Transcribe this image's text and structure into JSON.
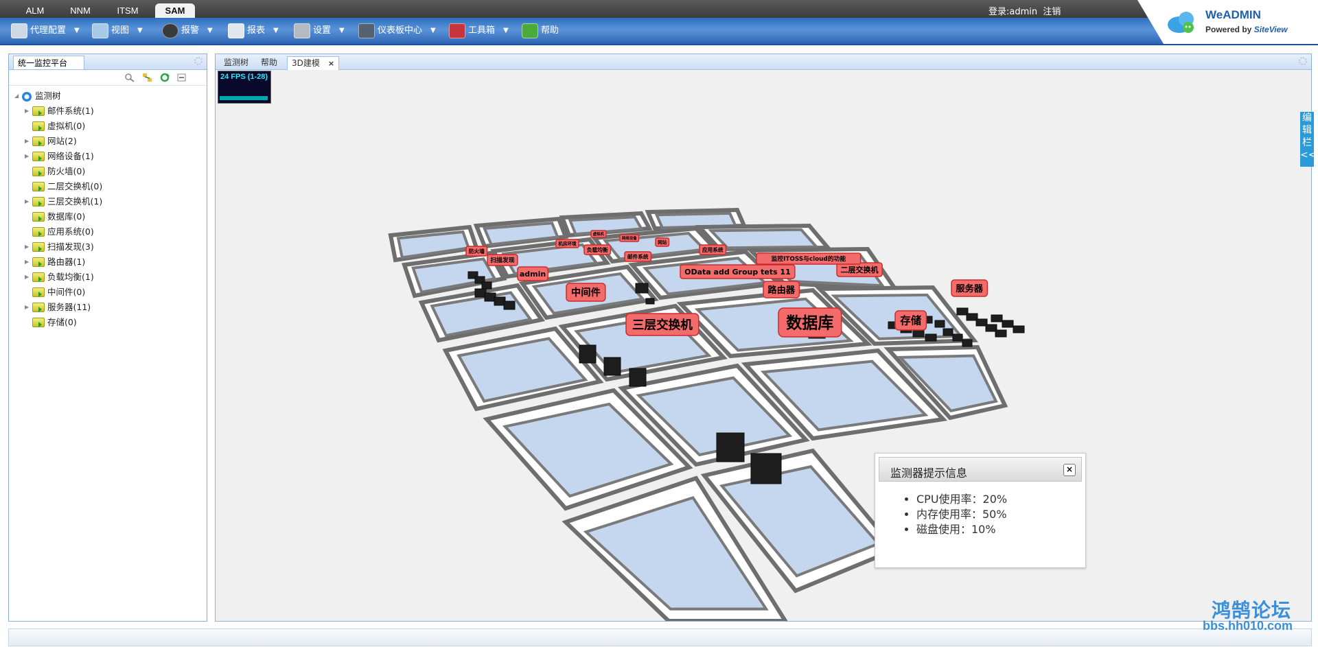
{
  "app_tabs": [
    "ALM",
    "NNM",
    "ITSM",
    "SAM"
  ],
  "login": {
    "user": "登录:admin",
    "logout": "注销"
  },
  "menu": [
    "代理配置",
    "视图",
    "报警",
    "报表",
    "设置",
    "仪表板中心",
    "工具箱",
    "帮助"
  ],
  "brand": {
    "name": "WeADMIN",
    "powered": "Powered by",
    "maker": "SiteView"
  },
  "left_panel": {
    "tab": "统一监控平台",
    "tree_root": "监测树",
    "tree_items": [
      {
        "label": "邮件系统(1)",
        "expandable": true
      },
      {
        "label": "虚拟机(0)",
        "expandable": false
      },
      {
        "label": "网站(2)",
        "expandable": true
      },
      {
        "label": "网络设备(1)",
        "expandable": true
      },
      {
        "label": "防火墙(0)",
        "expandable": false
      },
      {
        "label": "二层交换机(0)",
        "expandable": false
      },
      {
        "label": "三层交换机(1)",
        "expandable": true
      },
      {
        "label": "数据库(0)",
        "expandable": false
      },
      {
        "label": "应用系统(0)",
        "expandable": false
      },
      {
        "label": "扫描发现(3)",
        "expandable": true
      },
      {
        "label": "路由器(1)",
        "expandable": true
      },
      {
        "label": "负载均衡(1)",
        "expandable": true
      },
      {
        "label": "中间件(0)",
        "expandable": false
      },
      {
        "label": "服务器(11)",
        "expandable": true
      },
      {
        "label": "存储(0)",
        "expandable": false
      }
    ]
  },
  "right_panel": {
    "tabs": [
      {
        "label": "监测树",
        "active": false
      },
      {
        "label": "帮助",
        "active": false
      },
      {
        "label": "3D建模",
        "active": true,
        "close": "×"
      }
    ],
    "fps": "24 FPS (1-28)",
    "edit_bar": "编辑栏<<"
  },
  "scene_labels": [
    "数据库",
    "三层交换机",
    "存储",
    "中间件",
    "路由器",
    "服务器",
    "二层交换机",
    "OData add Group tets 11",
    "admin",
    "扫描发现",
    "防火墙",
    "邮件系统",
    "监控ITOSS与cloud的功能",
    "应用系统",
    "负载均衡",
    "机房环境",
    "网站",
    "网络设备",
    "虚拟机"
  ],
  "popup": {
    "title": "监测器提示信息",
    "close": "×",
    "items": [
      "CPU使用率：20%",
      "内存使用率：50%",
      "磁盘使用：10%"
    ]
  },
  "watermark": {
    "line1": "鸿鹄论坛",
    "line2": "bbs.hh010.com"
  },
  "colors": {
    "menubar": "#3a7ccc",
    "accent": "#1e5fb0",
    "label_bg": "#f36b6b",
    "floor": "#c5d6ef",
    "wall": "#707070"
  }
}
